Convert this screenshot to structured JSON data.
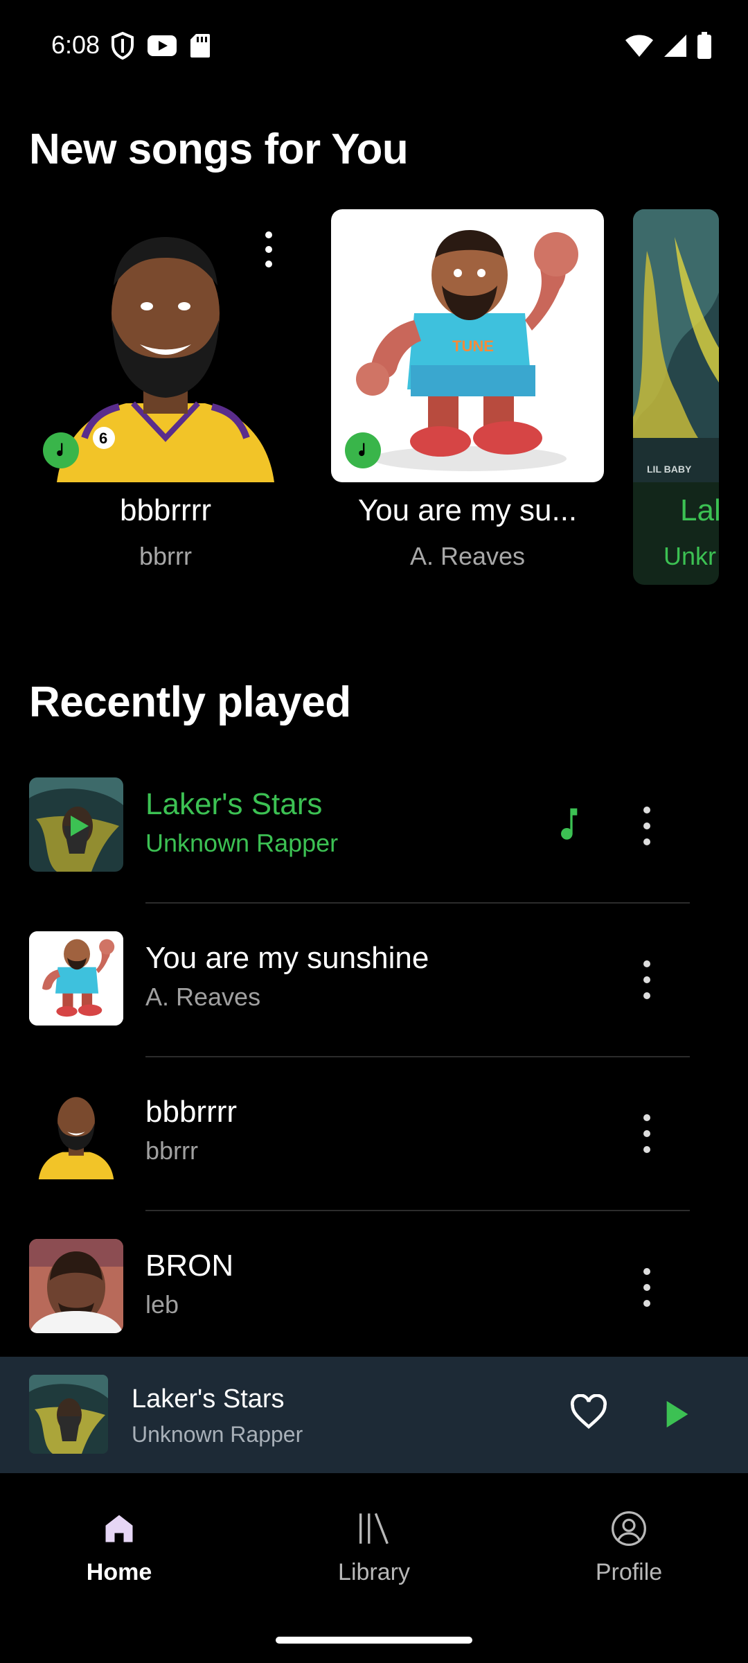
{
  "status_bar": {
    "time": "6:08"
  },
  "new_songs": {
    "title": "New songs for You",
    "cards": [
      {
        "title": "bbbrrrr",
        "subtitle": "bbrrr"
      },
      {
        "title": "You are my su...",
        "subtitle": "A. Reaves"
      },
      {
        "title": "Lal",
        "subtitle": "Unkr"
      }
    ]
  },
  "recent": {
    "title": "Recently played",
    "items": [
      {
        "title": "Laker's Stars",
        "subtitle": "Unknown Rapper"
      },
      {
        "title": "You are my sunshine",
        "subtitle": "A. Reaves"
      },
      {
        "title": "bbbrrrr",
        "subtitle": "bbrrr"
      },
      {
        "title": "BRON",
        "subtitle": "leb"
      }
    ]
  },
  "mini_player": {
    "title": "Laker's Stars",
    "subtitle": "Unknown Rapper"
  },
  "nav": {
    "home": "Home",
    "library": "Library",
    "profile": "Profile"
  },
  "colors": {
    "accent": "#3cc153",
    "mini_player_bg": "#1d2a36",
    "nav_active": "#e6d6f5"
  },
  "icons": {
    "status_left": [
      "shield-icon",
      "youtube-icon",
      "sd-card-icon"
    ],
    "status_right": [
      "wifi-icon",
      "signal-icon",
      "battery-icon"
    ],
    "card_badge": "music-note-icon",
    "more": "more-vertical-icon",
    "now_playing": "music-note-icon",
    "heart": "heart-icon",
    "play": "play-icon",
    "nav": [
      "home-icon",
      "library-icon",
      "profile-icon"
    ]
  }
}
